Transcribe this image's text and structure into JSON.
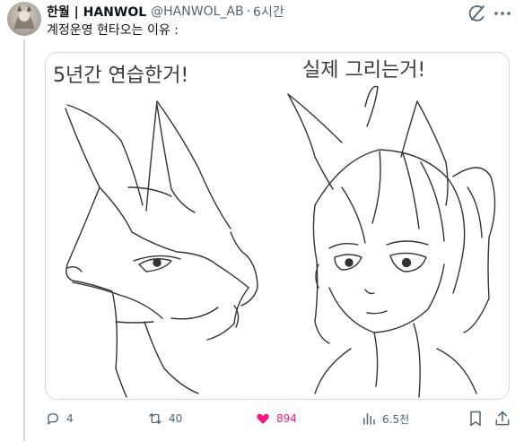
{
  "tweet": {
    "display_name": "한월 | HANWOL",
    "handle": "@HANWOL_AB",
    "separator": "·",
    "time": "6시간",
    "text": "계정운영 현타오는 이유 :",
    "avatar_icon": "avatar-image",
    "media": {
      "left_caption": "5년간 연습한거!",
      "right_caption": "실제 그리는거!",
      "left_subject": "fox-head-sketch",
      "right_subject": "fox-girl-sketch"
    }
  },
  "actions": {
    "replies": "4",
    "retweets": "40",
    "likes": "894",
    "views": "6.5천",
    "liked_color": "#f91880",
    "muted_color": "#536471"
  }
}
